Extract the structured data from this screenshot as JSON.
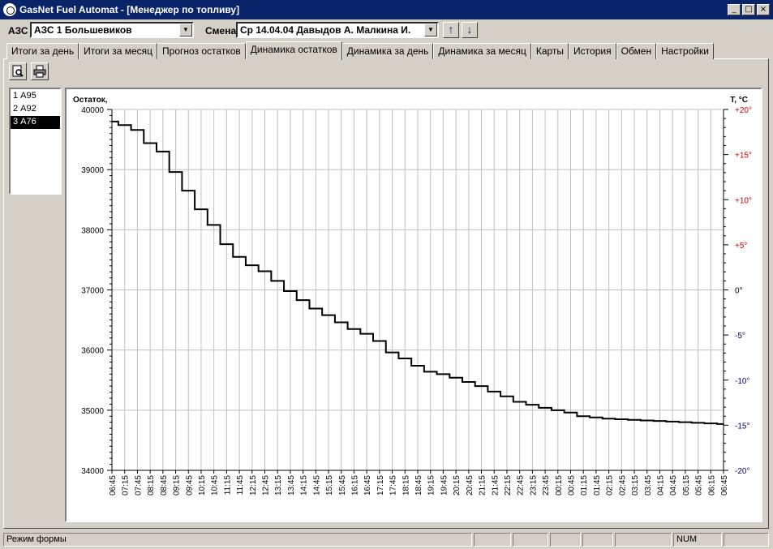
{
  "window": {
    "title": "GasNet Fuel Automat - [Менеджер по топливу]"
  },
  "toolbar": {
    "station_label": "АЗС",
    "station_value": "АЗС 1 Большевиков",
    "shift_label": "Смена",
    "shift_value": "Ср 14.04.04 Давыдов А. Малкина И."
  },
  "tabs": [
    "Итоги за день",
    "Итоги за месяц",
    "Прогноз остатков",
    "Динамика остатков",
    "Динамика за день",
    "Динамика за месяц",
    "Карты",
    "История",
    "Обмен",
    "Настройки"
  ],
  "active_tab": "Динамика остатков",
  "icons": {
    "preview": "print-preview-icon",
    "print": "printer-icon"
  },
  "fuel_list": [
    "1  А95",
    "2  А92",
    "3  А76"
  ],
  "selected_fuel": "3  А76",
  "status": {
    "mode": "Режим формы",
    "num": "NUM"
  },
  "colors": {
    "left_axis": "#000000",
    "right_axis_positive": "#cc0000",
    "right_axis_negative": "#000080",
    "titlebar": "#0a246a"
  },
  "chart_data": {
    "type": "line",
    "ylabel": "Остаток,",
    "y2label": "T, °C",
    "ylim": [
      34000,
      40000
    ],
    "y2lim": [
      -20,
      20
    ],
    "yticks": [
      "40000",
      "39000",
      "38000",
      "37000",
      "36000",
      "35000",
      "34000"
    ],
    "y2ticks": [
      "+20°",
      "+15°",
      "+10°",
      "+5°",
      "0°",
      "-5°",
      "-10°",
      "-15°",
      "-20°"
    ],
    "grid": true,
    "x": [
      "06:45",
      "07:15",
      "07:45",
      "08:15",
      "08:45",
      "09:15",
      "09:45",
      "10:15",
      "10:45",
      "11:15",
      "11:45",
      "12:15",
      "12:45",
      "13:15",
      "13:45",
      "14:15",
      "14:45",
      "15:15",
      "15:45",
      "16:15",
      "16:45",
      "17:15",
      "17:45",
      "18:15",
      "18:45",
      "19:15",
      "19:45",
      "20:15",
      "20:45",
      "21:15",
      "21:45",
      "22:15",
      "22:45",
      "23:15",
      "23:45",
      "00:15",
      "00:45",
      "01:15",
      "01:45",
      "02:15",
      "02:45",
      "03:15",
      "03:45",
      "04:15",
      "04:45",
      "05:15",
      "05:45",
      "06:15",
      "06:45"
    ],
    "series": [
      {
        "values": [
          39800,
          39740,
          39660,
          39440,
          39300,
          38960,
          38650,
          38340,
          38080,
          37760,
          37550,
          37410,
          37310,
          37150,
          36980,
          36830,
          36690,
          36580,
          36460,
          36350,
          36270,
          36150,
          35960,
          35860,
          35740,
          35640,
          35600,
          35540,
          35470,
          35400,
          35310,
          35230,
          35140,
          35090,
          35040,
          35000,
          34960,
          34900,
          34880,
          34860,
          34850,
          34840,
          34830,
          34820,
          34810,
          34800,
          34790,
          34780,
          34770
        ]
      }
    ]
  }
}
